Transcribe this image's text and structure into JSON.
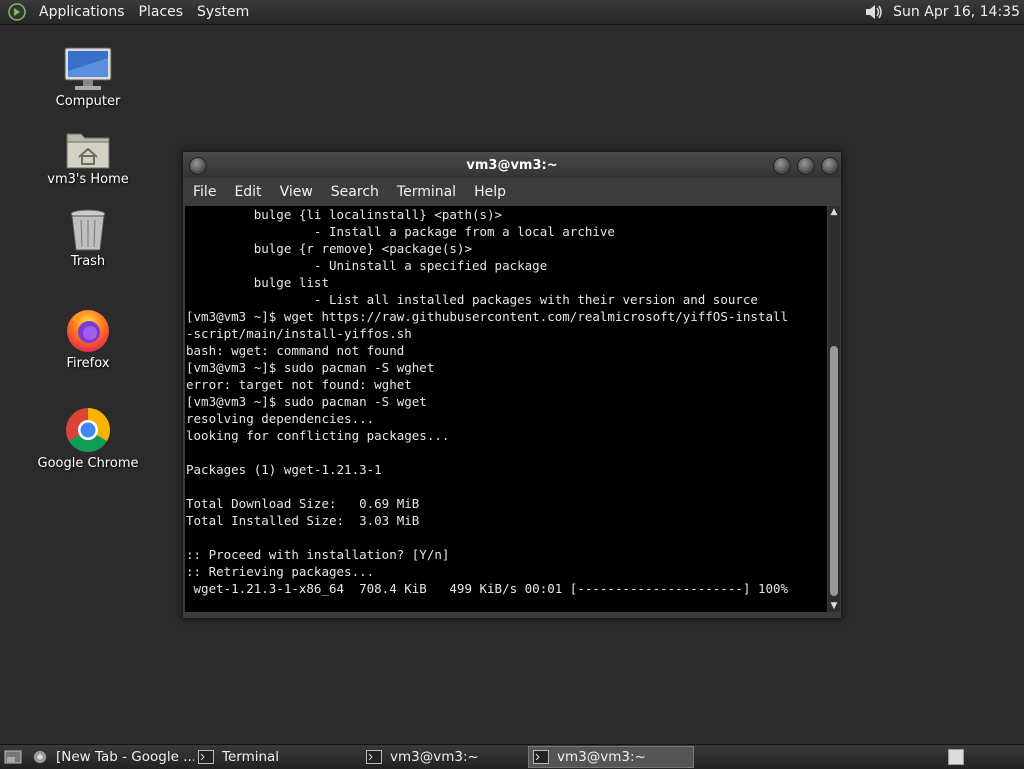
{
  "top_panel": {
    "menus": [
      "Applications",
      "Places",
      "System"
    ],
    "clock": "Sun Apr 16, 14:35",
    "icons": [
      "distro-logo-icon",
      "volume-icon"
    ]
  },
  "desktop_icons": [
    {
      "label": "Computer",
      "icon": "computer-monitor-icon"
    },
    {
      "label": "vm3's Home",
      "icon": "home-folder-icon"
    },
    {
      "label": "Trash",
      "icon": "trash-can-icon"
    },
    {
      "label": "Firefox",
      "icon": "firefox-icon"
    },
    {
      "label": "Google Chrome",
      "icon": "chrome-icon"
    }
  ],
  "window": {
    "title": "vm3@vm3:~",
    "menu": [
      "File",
      "Edit",
      "View",
      "Search",
      "Terminal",
      "Help"
    ],
    "terminal_lines": [
      "         bulge {li localinstall} <path(s)>",
      "                 - Install a package from a local archive",
      "         bulge {r remove} <package(s)>",
      "                 - Uninstall a specified package",
      "         bulge list",
      "                 - List all installed packages with their version and source",
      "[vm3@vm3 ~]$ wget https://raw.githubusercontent.com/realmicrosoft/yiffOS-install",
      "-script/main/install-yiffos.sh",
      "bash: wget: command not found",
      "[vm3@vm3 ~]$ sudo pacman -S wghet",
      "error: target not found: wghet",
      "[vm3@vm3 ~]$ sudo pacman -S wget",
      "resolving dependencies...",
      "looking for conflicting packages...",
      "",
      "Packages (1) wget-1.21.3-1",
      "",
      "Total Download Size:   0.69 MiB",
      "Total Installed Size:  3.03 MiB",
      "",
      ":: Proceed with installation? [Y/n]",
      ":: Retrieving packages...",
      " wget-1.21.3-1-x86_64  708.4 KiB   499 KiB/s 00:01 [----------------------] 100%"
    ],
    "scroll_position": 0.9
  },
  "taskbar": {
    "tasks": [
      {
        "label": "[New Tab - Google ...",
        "icon": "chrome-icon",
        "active": false
      },
      {
        "label": "Terminal",
        "icon": "terminal-icon",
        "active": false
      },
      {
        "label": "vm3@vm3:~",
        "icon": "terminal-icon",
        "active": false
      },
      {
        "label": "vm3@vm3:~",
        "icon": "terminal-icon",
        "active": true
      }
    ]
  },
  "colors": {
    "desktop_bg": "#2b2b2b",
    "terminal_bg": "#000000",
    "terminal_fg": "#e6e6e6"
  }
}
